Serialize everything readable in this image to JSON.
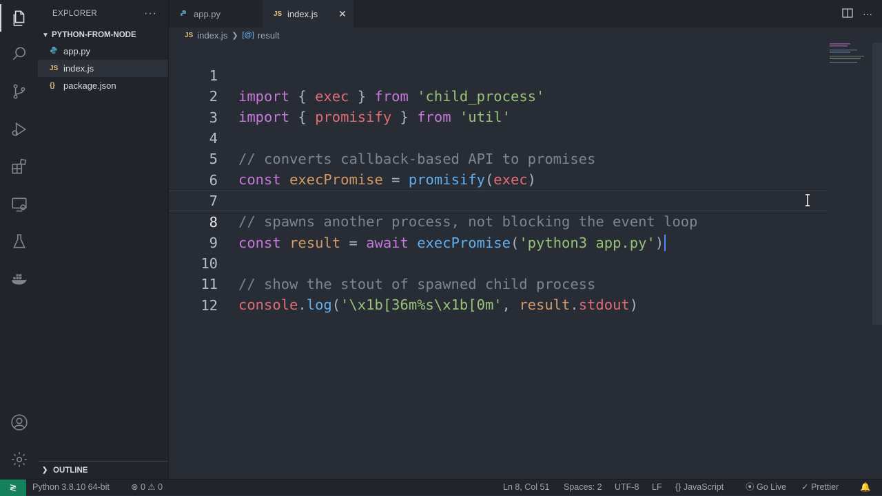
{
  "sidebar": {
    "title": "EXPLORER",
    "more": "···",
    "folder": "PYTHON-FROM-NODE",
    "files": [
      {
        "icon": "python-icon",
        "label": "app.py"
      },
      {
        "icon": "js-icon",
        "label": "index.js"
      },
      {
        "icon": "json-icon",
        "label": "package.json"
      }
    ],
    "outline": "OUTLINE"
  },
  "tabs": [
    {
      "label": "app.py",
      "active": false
    },
    {
      "label": "index.js",
      "active": true
    }
  ],
  "breadcrumb": {
    "file": "index.js",
    "symbol": "result"
  },
  "editor": {
    "line_numbers": [
      "1",
      "2",
      "3",
      "4",
      "5",
      "6",
      "7",
      "8",
      "9",
      "10",
      "11",
      "12"
    ],
    "current_line": 8
  },
  "status": {
    "python": "Python 3.8.10 64-bit",
    "errors": "0",
    "warnings": "0",
    "position": "Ln 8, Col 51",
    "spaces": "Spaces: 2",
    "encoding": "UTF-8",
    "eol": "LF",
    "language": "JavaScript",
    "golive": "Go Live",
    "prettier": "Prettier"
  },
  "colors": {
    "background": "#282c34",
    "keyword": "#c678dd",
    "string": "#98c379",
    "comment": "#7f848e",
    "function": "#61afef",
    "variable": "#e06c75",
    "remote_badge": "#16825d",
    "js_yellow": "#e5c07b"
  }
}
